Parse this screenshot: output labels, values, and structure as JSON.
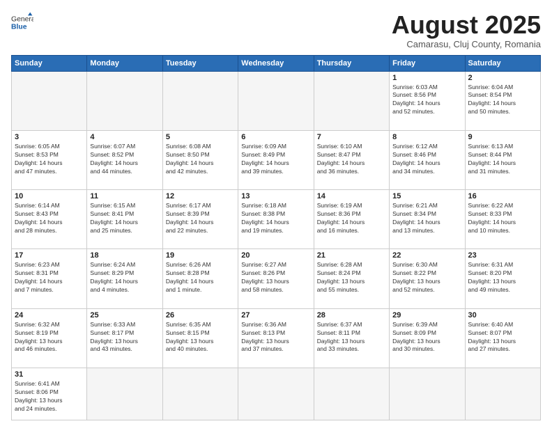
{
  "header": {
    "logo_general": "General",
    "logo_blue": "Blue",
    "month": "August 2025",
    "location": "Camarasu, Cluj County, Romania"
  },
  "weekdays": [
    "Sunday",
    "Monday",
    "Tuesday",
    "Wednesday",
    "Thursday",
    "Friday",
    "Saturday"
  ],
  "weeks": [
    [
      {
        "day": "",
        "info": ""
      },
      {
        "day": "",
        "info": ""
      },
      {
        "day": "",
        "info": ""
      },
      {
        "day": "",
        "info": ""
      },
      {
        "day": "",
        "info": ""
      },
      {
        "day": "1",
        "info": "Sunrise: 6:03 AM\nSunset: 8:56 PM\nDaylight: 14 hours\nand 52 minutes."
      },
      {
        "day": "2",
        "info": "Sunrise: 6:04 AM\nSunset: 8:54 PM\nDaylight: 14 hours\nand 50 minutes."
      }
    ],
    [
      {
        "day": "3",
        "info": "Sunrise: 6:05 AM\nSunset: 8:53 PM\nDaylight: 14 hours\nand 47 minutes."
      },
      {
        "day": "4",
        "info": "Sunrise: 6:07 AM\nSunset: 8:52 PM\nDaylight: 14 hours\nand 44 minutes."
      },
      {
        "day": "5",
        "info": "Sunrise: 6:08 AM\nSunset: 8:50 PM\nDaylight: 14 hours\nand 42 minutes."
      },
      {
        "day": "6",
        "info": "Sunrise: 6:09 AM\nSunset: 8:49 PM\nDaylight: 14 hours\nand 39 minutes."
      },
      {
        "day": "7",
        "info": "Sunrise: 6:10 AM\nSunset: 8:47 PM\nDaylight: 14 hours\nand 36 minutes."
      },
      {
        "day": "8",
        "info": "Sunrise: 6:12 AM\nSunset: 8:46 PM\nDaylight: 14 hours\nand 34 minutes."
      },
      {
        "day": "9",
        "info": "Sunrise: 6:13 AM\nSunset: 8:44 PM\nDaylight: 14 hours\nand 31 minutes."
      }
    ],
    [
      {
        "day": "10",
        "info": "Sunrise: 6:14 AM\nSunset: 8:43 PM\nDaylight: 14 hours\nand 28 minutes."
      },
      {
        "day": "11",
        "info": "Sunrise: 6:15 AM\nSunset: 8:41 PM\nDaylight: 14 hours\nand 25 minutes."
      },
      {
        "day": "12",
        "info": "Sunrise: 6:17 AM\nSunset: 8:39 PM\nDaylight: 14 hours\nand 22 minutes."
      },
      {
        "day": "13",
        "info": "Sunrise: 6:18 AM\nSunset: 8:38 PM\nDaylight: 14 hours\nand 19 minutes."
      },
      {
        "day": "14",
        "info": "Sunrise: 6:19 AM\nSunset: 8:36 PM\nDaylight: 14 hours\nand 16 minutes."
      },
      {
        "day": "15",
        "info": "Sunrise: 6:21 AM\nSunset: 8:34 PM\nDaylight: 14 hours\nand 13 minutes."
      },
      {
        "day": "16",
        "info": "Sunrise: 6:22 AM\nSunset: 8:33 PM\nDaylight: 14 hours\nand 10 minutes."
      }
    ],
    [
      {
        "day": "17",
        "info": "Sunrise: 6:23 AM\nSunset: 8:31 PM\nDaylight: 14 hours\nand 7 minutes."
      },
      {
        "day": "18",
        "info": "Sunrise: 6:24 AM\nSunset: 8:29 PM\nDaylight: 14 hours\nand 4 minutes."
      },
      {
        "day": "19",
        "info": "Sunrise: 6:26 AM\nSunset: 8:28 PM\nDaylight: 14 hours\nand 1 minute."
      },
      {
        "day": "20",
        "info": "Sunrise: 6:27 AM\nSunset: 8:26 PM\nDaylight: 13 hours\nand 58 minutes."
      },
      {
        "day": "21",
        "info": "Sunrise: 6:28 AM\nSunset: 8:24 PM\nDaylight: 13 hours\nand 55 minutes."
      },
      {
        "day": "22",
        "info": "Sunrise: 6:30 AM\nSunset: 8:22 PM\nDaylight: 13 hours\nand 52 minutes."
      },
      {
        "day": "23",
        "info": "Sunrise: 6:31 AM\nSunset: 8:20 PM\nDaylight: 13 hours\nand 49 minutes."
      }
    ],
    [
      {
        "day": "24",
        "info": "Sunrise: 6:32 AM\nSunset: 8:19 PM\nDaylight: 13 hours\nand 46 minutes."
      },
      {
        "day": "25",
        "info": "Sunrise: 6:33 AM\nSunset: 8:17 PM\nDaylight: 13 hours\nand 43 minutes."
      },
      {
        "day": "26",
        "info": "Sunrise: 6:35 AM\nSunset: 8:15 PM\nDaylight: 13 hours\nand 40 minutes."
      },
      {
        "day": "27",
        "info": "Sunrise: 6:36 AM\nSunset: 8:13 PM\nDaylight: 13 hours\nand 37 minutes."
      },
      {
        "day": "28",
        "info": "Sunrise: 6:37 AM\nSunset: 8:11 PM\nDaylight: 13 hours\nand 33 minutes."
      },
      {
        "day": "29",
        "info": "Sunrise: 6:39 AM\nSunset: 8:09 PM\nDaylight: 13 hours\nand 30 minutes."
      },
      {
        "day": "30",
        "info": "Sunrise: 6:40 AM\nSunset: 8:07 PM\nDaylight: 13 hours\nand 27 minutes."
      }
    ],
    [
      {
        "day": "31",
        "info": "Sunrise: 6:41 AM\nSunset: 8:06 PM\nDaylight: 13 hours\nand 24 minutes."
      },
      {
        "day": "",
        "info": ""
      },
      {
        "day": "",
        "info": ""
      },
      {
        "day": "",
        "info": ""
      },
      {
        "day": "",
        "info": ""
      },
      {
        "day": "",
        "info": ""
      },
      {
        "day": "",
        "info": ""
      }
    ]
  ]
}
